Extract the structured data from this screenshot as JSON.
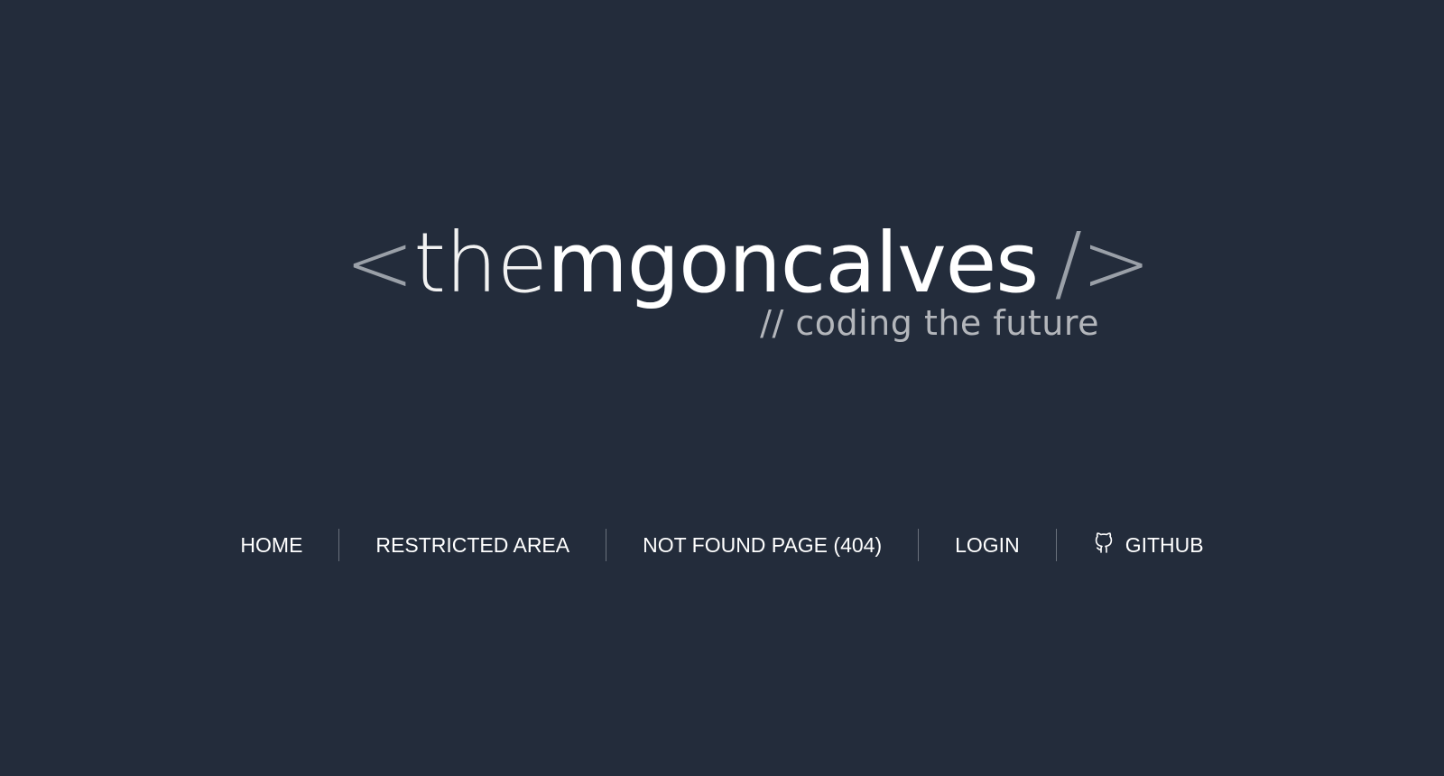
{
  "logo": {
    "open_bracket": "<",
    "prefix": "the",
    "name": "mgoncalves",
    "close_bracket": "/>",
    "tagline": "// coding the future"
  },
  "nav": {
    "items": [
      {
        "label": "HOME"
      },
      {
        "label": "RESTRICTED AREA"
      },
      {
        "label": "NOT FOUND PAGE (404)"
      },
      {
        "label": "LOGIN"
      },
      {
        "label": "GITHUB",
        "icon": "github-icon"
      }
    ]
  },
  "colors": {
    "background": "#232c3b",
    "text": "#ffffff",
    "muted": "#9aa0a8",
    "separator": "#6a717c"
  }
}
